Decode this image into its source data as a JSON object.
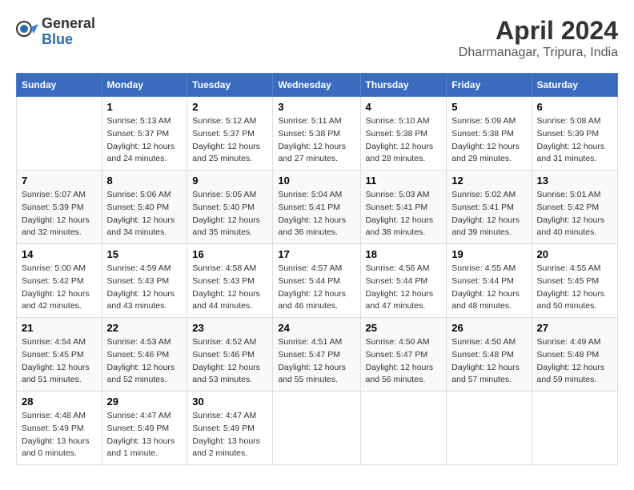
{
  "header": {
    "logo_general": "General",
    "logo_blue": "Blue",
    "month": "April 2024",
    "location": "Dharmanagar, Tripura, India"
  },
  "columns": [
    "Sunday",
    "Monday",
    "Tuesday",
    "Wednesday",
    "Thursday",
    "Friday",
    "Saturday"
  ],
  "weeks": [
    [
      {
        "day": "",
        "info": ""
      },
      {
        "day": "1",
        "info": "Sunrise: 5:13 AM\nSunset: 5:37 PM\nDaylight: 12 hours\nand 24 minutes."
      },
      {
        "day": "2",
        "info": "Sunrise: 5:12 AM\nSunset: 5:37 PM\nDaylight: 12 hours\nand 25 minutes."
      },
      {
        "day": "3",
        "info": "Sunrise: 5:11 AM\nSunset: 5:38 PM\nDaylight: 12 hours\nand 27 minutes."
      },
      {
        "day": "4",
        "info": "Sunrise: 5:10 AM\nSunset: 5:38 PM\nDaylight: 12 hours\nand 28 minutes."
      },
      {
        "day": "5",
        "info": "Sunrise: 5:09 AM\nSunset: 5:38 PM\nDaylight: 12 hours\nand 29 minutes."
      },
      {
        "day": "6",
        "info": "Sunrise: 5:08 AM\nSunset: 5:39 PM\nDaylight: 12 hours\nand 31 minutes."
      }
    ],
    [
      {
        "day": "7",
        "info": "Sunrise: 5:07 AM\nSunset: 5:39 PM\nDaylight: 12 hours\nand 32 minutes."
      },
      {
        "day": "8",
        "info": "Sunrise: 5:06 AM\nSunset: 5:40 PM\nDaylight: 12 hours\nand 34 minutes."
      },
      {
        "day": "9",
        "info": "Sunrise: 5:05 AM\nSunset: 5:40 PM\nDaylight: 12 hours\nand 35 minutes."
      },
      {
        "day": "10",
        "info": "Sunrise: 5:04 AM\nSunset: 5:41 PM\nDaylight: 12 hours\nand 36 minutes."
      },
      {
        "day": "11",
        "info": "Sunrise: 5:03 AM\nSunset: 5:41 PM\nDaylight: 12 hours\nand 38 minutes."
      },
      {
        "day": "12",
        "info": "Sunrise: 5:02 AM\nSunset: 5:41 PM\nDaylight: 12 hours\nand 39 minutes."
      },
      {
        "day": "13",
        "info": "Sunrise: 5:01 AM\nSunset: 5:42 PM\nDaylight: 12 hours\nand 40 minutes."
      }
    ],
    [
      {
        "day": "14",
        "info": "Sunrise: 5:00 AM\nSunset: 5:42 PM\nDaylight: 12 hours\nand 42 minutes."
      },
      {
        "day": "15",
        "info": "Sunrise: 4:59 AM\nSunset: 5:43 PM\nDaylight: 12 hours\nand 43 minutes."
      },
      {
        "day": "16",
        "info": "Sunrise: 4:58 AM\nSunset: 5:43 PM\nDaylight: 12 hours\nand 44 minutes."
      },
      {
        "day": "17",
        "info": "Sunrise: 4:57 AM\nSunset: 5:44 PM\nDaylight: 12 hours\nand 46 minutes."
      },
      {
        "day": "18",
        "info": "Sunrise: 4:56 AM\nSunset: 5:44 PM\nDaylight: 12 hours\nand 47 minutes."
      },
      {
        "day": "19",
        "info": "Sunrise: 4:55 AM\nSunset: 5:44 PM\nDaylight: 12 hours\nand 48 minutes."
      },
      {
        "day": "20",
        "info": "Sunrise: 4:55 AM\nSunset: 5:45 PM\nDaylight: 12 hours\nand 50 minutes."
      }
    ],
    [
      {
        "day": "21",
        "info": "Sunrise: 4:54 AM\nSunset: 5:45 PM\nDaylight: 12 hours\nand 51 minutes."
      },
      {
        "day": "22",
        "info": "Sunrise: 4:53 AM\nSunset: 5:46 PM\nDaylight: 12 hours\nand 52 minutes."
      },
      {
        "day": "23",
        "info": "Sunrise: 4:52 AM\nSunset: 5:46 PM\nDaylight: 12 hours\nand 53 minutes."
      },
      {
        "day": "24",
        "info": "Sunrise: 4:51 AM\nSunset: 5:47 PM\nDaylight: 12 hours\nand 55 minutes."
      },
      {
        "day": "25",
        "info": "Sunrise: 4:50 AM\nSunset: 5:47 PM\nDaylight: 12 hours\nand 56 minutes."
      },
      {
        "day": "26",
        "info": "Sunrise: 4:50 AM\nSunset: 5:48 PM\nDaylight: 12 hours\nand 57 minutes."
      },
      {
        "day": "27",
        "info": "Sunrise: 4:49 AM\nSunset: 5:48 PM\nDaylight: 12 hours\nand 59 minutes."
      }
    ],
    [
      {
        "day": "28",
        "info": "Sunrise: 4:48 AM\nSunset: 5:49 PM\nDaylight: 13 hours\nand 0 minutes."
      },
      {
        "day": "29",
        "info": "Sunrise: 4:47 AM\nSunset: 5:49 PM\nDaylight: 13 hours\nand 1 minute."
      },
      {
        "day": "30",
        "info": "Sunrise: 4:47 AM\nSunset: 5:49 PM\nDaylight: 13 hours\nand 2 minutes."
      },
      {
        "day": "",
        "info": ""
      },
      {
        "day": "",
        "info": ""
      },
      {
        "day": "",
        "info": ""
      },
      {
        "day": "",
        "info": ""
      }
    ]
  ]
}
